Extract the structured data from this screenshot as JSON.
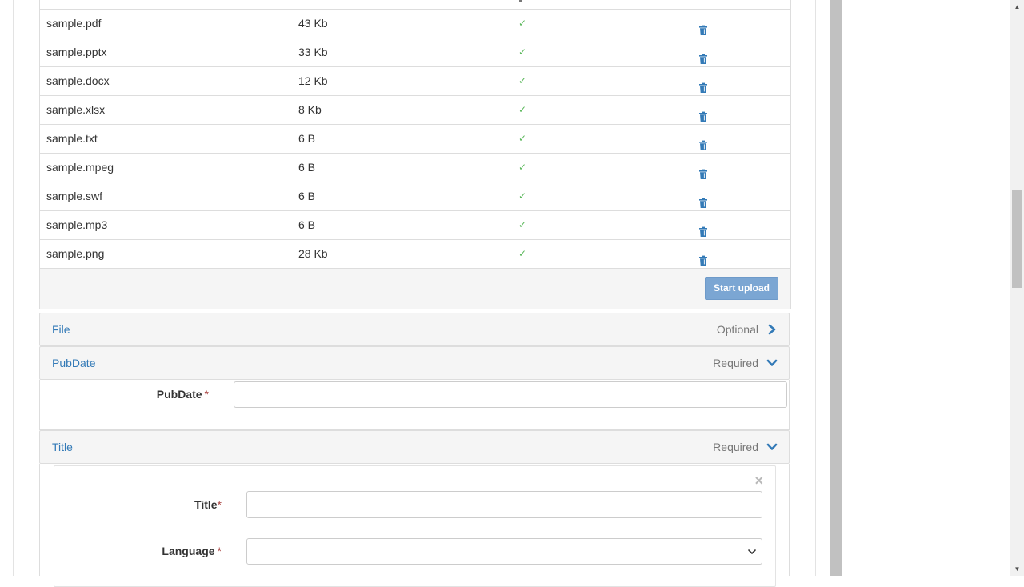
{
  "files": [
    {
      "name": "sample.pdf",
      "size": "43 Kb"
    },
    {
      "name": "sample.pptx",
      "size": "33 Kb"
    },
    {
      "name": "sample.docx",
      "size": "12 Kb"
    },
    {
      "name": "sample.xlsx",
      "size": "8 Kb"
    },
    {
      "name": "sample.txt",
      "size": "6 B"
    },
    {
      "name": "sample.mpeg",
      "size": "6 B"
    },
    {
      "name": "sample.swf",
      "size": "6 B"
    },
    {
      "name": "sample.mp3",
      "size": "6 B"
    },
    {
      "name": "sample.png",
      "size": "28 Kb"
    }
  ],
  "icons": {
    "check": "check-icon",
    "delete": "trash-icon"
  },
  "upload": {
    "start_label": "Start upload"
  },
  "panels": {
    "file": {
      "title": "File",
      "status": "Optional"
    },
    "pubdate": {
      "title": "PubDate",
      "status": "Required"
    },
    "title": {
      "title": "Title",
      "status": "Required"
    }
  },
  "form": {
    "pubdate_label": "PubDate",
    "title_label": "Title",
    "language_label": "Language",
    "required_mark": "*",
    "close_symbol": "×"
  },
  "colors": {
    "link": "#337ab7",
    "check": "#5cb85c",
    "button": "#7ba6d3",
    "required": "#a94442"
  }
}
